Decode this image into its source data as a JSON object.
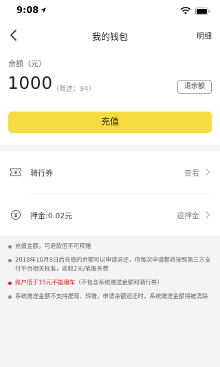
{
  "status_bar": {
    "time": "9:08"
  },
  "nav": {
    "title": "我的钱包",
    "detail": "明细"
  },
  "balance": {
    "label": "余额（元）",
    "amount": "1000",
    "gift": "（赠送：94）",
    "refund_button": "退余额",
    "recharge_button": "充值"
  },
  "rows": [
    {
      "label": "骑行券",
      "action": "查看"
    },
    {
      "label": "押金:0.02元",
      "action": "退押金"
    }
  ],
  "notes": [
    {
      "text": "充值金额，可退款但不可转赠"
    },
    {
      "text": "2018年10月8日后充值的余额可以申请退还，但每次申请都将按照第三方支付平台相关标准，收取2元/笔服务费"
    },
    {
      "warn": "账户低于15元不能用车",
      "paren": "（不包含系统赠送金额和骑行券）"
    },
    {
      "text": "系统赠送金额不支持提现、转赠，申请余额退还时，系统赠送金额将被清除"
    }
  ],
  "colors": {
    "accent": "#f6dc3e",
    "warning": "#e02020"
  }
}
